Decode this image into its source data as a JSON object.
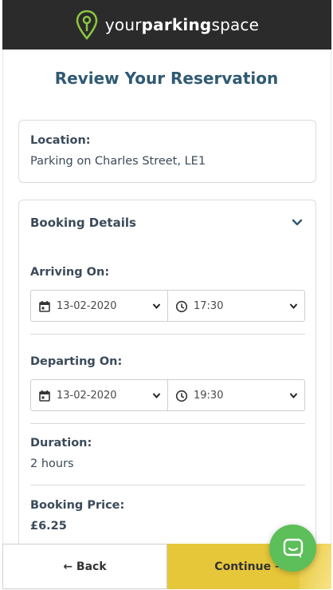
{
  "header": {
    "brand_part1": "your",
    "brand_part2": "parking",
    "brand_part3": "space"
  },
  "page": {
    "title": "Review Your Reservation"
  },
  "location": {
    "label": "Location:",
    "value": "Parking on Charles Street, LE1"
  },
  "booking_details": {
    "title": "Booking Details",
    "arriving": {
      "label": "Arriving On:",
      "date": "13-02-2020",
      "time": "17:30"
    },
    "departing": {
      "label": "Departing On:",
      "date": "13-02-2020",
      "time": "19:30"
    },
    "duration": {
      "label": "Duration:",
      "value": "2 hours"
    },
    "price": {
      "label": "Booking Price:",
      "value": "£6.25"
    }
  },
  "actions": {
    "back_label": "← Back",
    "continue_label": "Continue →"
  },
  "colors": {
    "header_bg": "#2b2b2b",
    "brand_green": "#8cc63f",
    "title_blue": "#2f5a72",
    "continue_yellow": "#e7c73a",
    "chat_green": "#5cbf5a"
  }
}
